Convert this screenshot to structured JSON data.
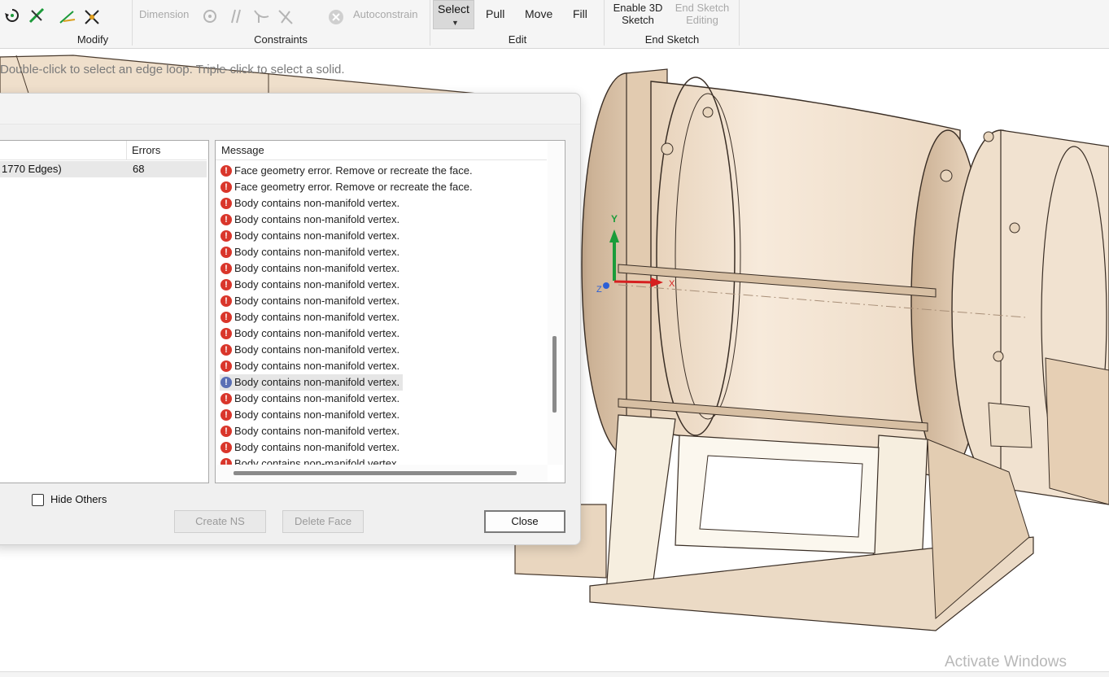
{
  "ribbon": {
    "groups": {
      "modify": "Modify",
      "constraints": "Constraints",
      "edit": "Edit",
      "end_sketch": "End Sketch"
    },
    "dimension_label": "Dimension",
    "autoconstrain_label": "Autoconstrain",
    "select_label": "Select",
    "pull_label": "Pull",
    "move_label": "Move",
    "fill_label": "Fill",
    "enable3d_line1": "Enable 3D",
    "enable3d_line2": "Sketch",
    "end_sketch_line1": "End Sketch",
    "end_sketch_line2": "Editing"
  },
  "viewport": {
    "hint": "Double-click to select an edge loop. Triple-click to select a solid.",
    "triad_y": "Y",
    "triad_x": "X",
    "triad_z": "Z"
  },
  "dialog": {
    "left_table": {
      "col_errors": "Errors",
      "rows": [
        {
          "name": "1770 Edges)",
          "errors": "68"
        }
      ]
    },
    "messages": {
      "header": "Message",
      "rows": [
        {
          "text": "Face geometry error. Remove or recreate the face.",
          "kind": "error"
        },
        {
          "text": "Face geometry error. Remove or recreate the face.",
          "kind": "error"
        },
        {
          "text": "Body contains non-manifold vertex.",
          "kind": "error"
        },
        {
          "text": "Body contains non-manifold vertex.",
          "kind": "error"
        },
        {
          "text": "Body contains non-manifold vertex.",
          "kind": "error"
        },
        {
          "text": "Body contains non-manifold vertex.",
          "kind": "error"
        },
        {
          "text": "Body contains non-manifold vertex.",
          "kind": "error"
        },
        {
          "text": "Body contains non-manifold vertex.",
          "kind": "error"
        },
        {
          "text": "Body contains non-manifold vertex.",
          "kind": "error"
        },
        {
          "text": "Body contains non-manifold vertex.",
          "kind": "error"
        },
        {
          "text": "Body contains non-manifold vertex.",
          "kind": "error"
        },
        {
          "text": "Body contains non-manifold vertex.",
          "kind": "error"
        },
        {
          "text": "Body contains non-manifold vertex.",
          "kind": "error"
        },
        {
          "text": "Body contains non-manifold vertex.",
          "kind": "selected"
        },
        {
          "text": "Body contains non-manifold vertex.",
          "kind": "error"
        },
        {
          "text": "Body contains non-manifold vertex.",
          "kind": "error"
        },
        {
          "text": "Body contains non-manifold vertex.",
          "kind": "error"
        },
        {
          "text": "Body contains non-manifold vertex.",
          "kind": "error"
        },
        {
          "text": "Body contains non-manifold vertex.",
          "kind": "error"
        }
      ]
    },
    "hide_others_label": "Hide Others",
    "create_ns_label": "Create NS",
    "delete_face_label": "Delete Face",
    "close_label": "Close"
  },
  "watermark": "Activate Windows",
  "colors": {
    "error_icon": "#d9362b",
    "selected_icon": "#5a6fb5",
    "model_fill": "#f3e4d2",
    "model_edge": "#3a2e25"
  }
}
